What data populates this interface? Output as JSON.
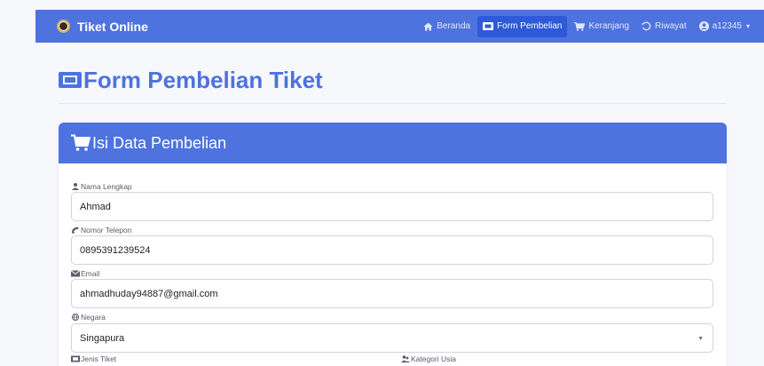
{
  "navbar": {
    "brand": "Tiket Online",
    "items": [
      {
        "label": "Beranda",
        "icon": "home-icon"
      },
      {
        "label": "Form Pembelian",
        "icon": "ticket-icon",
        "active": true
      },
      {
        "label": "Keranjang",
        "icon": "cart-icon"
      },
      {
        "label": "Riwayat",
        "icon": "history-icon"
      },
      {
        "label": "a12345",
        "icon": "user-circle-icon",
        "dropdown": true
      }
    ],
    "color": "#4e73df",
    "active_color": "#2e59d9"
  },
  "page": {
    "title": "Form Pembelian Tiket",
    "title_color": "#4e73df"
  },
  "card": {
    "header": "Isi Data Pembelian",
    "fields": {
      "nama": {
        "label": "Nama Lengkap",
        "value": "Ahmad"
      },
      "telepon": {
        "label": "Nomor Telepon",
        "value": "0895391239524"
      },
      "email": {
        "label": "Email",
        "value": "ahmadhuday94887@gmail.com"
      },
      "negara": {
        "label": "Negara",
        "value": "Singapura"
      },
      "jenis_tiket": {
        "label": "Jenis Tiket"
      },
      "kategori_usia": {
        "label": "Kategori Usia"
      }
    }
  }
}
